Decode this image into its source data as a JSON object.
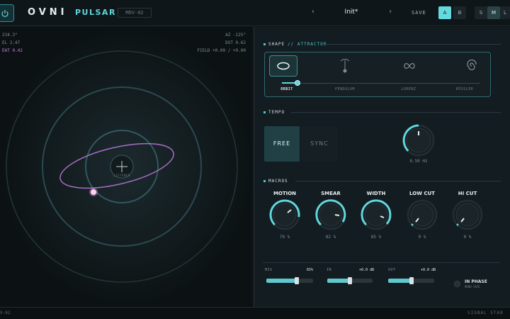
{
  "header": {
    "brand": "OVNI",
    "product": "PULSAR",
    "version": "MOV-02",
    "preset": "Init*",
    "prev": "‹",
    "next": "›",
    "save": "SAVE",
    "ab": [
      "A",
      "B"
    ],
    "size": [
      "S",
      "M",
      "L"
    ]
  },
  "viz": {
    "stats_left": [
      "234.3°",
      "EL 2.47",
      "EAT 0.42"
    ],
    "stats_right": [
      "AZ -125°",
      "DST 0.62",
      "FIELD +0.00 / +0.00"
    ],
    "center_label": "LISTENER"
  },
  "shape": {
    "title": "SHAPE",
    "subtitle": "// ATTRACTOR",
    "labels": [
      "ORBIT",
      "PENDULUM",
      "LORENZ",
      "RÖSSLER"
    ],
    "selected": 0
  },
  "tempo": {
    "title": "TEMPO",
    "free": "FREE",
    "sync": "SYNC",
    "rate": "0.50 Hz"
  },
  "macros": {
    "title": "MACROS",
    "knobs": [
      {
        "label": "MOTION",
        "value": "70 %"
      },
      {
        "label": "SMEAR",
        "value": "82 %"
      },
      {
        "label": "WIDTH",
        "value": "85 %"
      },
      {
        "label": "LOW CUT",
        "value": "0 %"
      },
      {
        "label": "HI CUT",
        "value": "0 %"
      }
    ]
  },
  "output": {
    "mix_label": "MIX",
    "mix_value": "65%",
    "in_label": "IN",
    "in_value": "+0.0 dB",
    "out_label": "OUT",
    "out_value": "+0.0 dB",
    "phase_label": "IN PHASE",
    "phase_sub": "MONO SAFE"
  },
  "status": {
    "left": "V-02",
    "right": "SIGNAL STAB"
  },
  "colors": {
    "accent": "#5fd6dc",
    "orbit": "#c07be0",
    "point": "#ff9ee0"
  }
}
